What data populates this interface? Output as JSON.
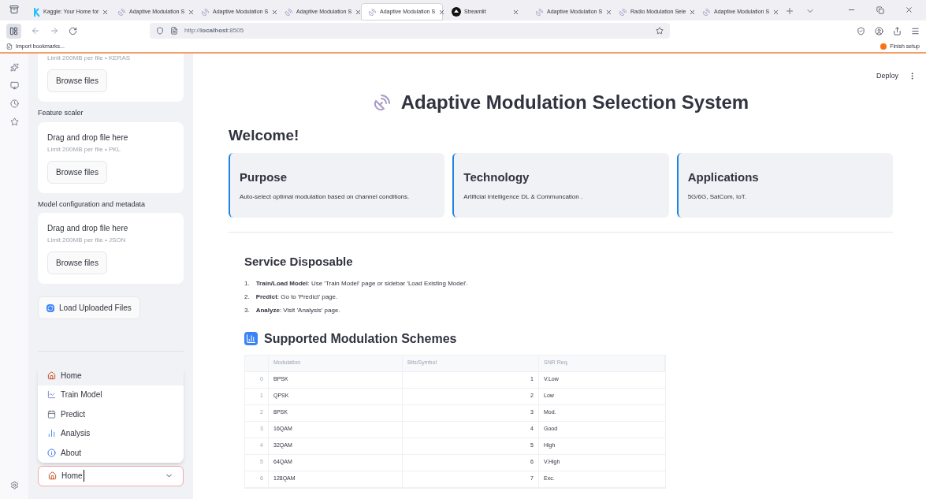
{
  "browser": {
    "tabs": [
      {
        "title": "Kaggle: Your Home for",
        "kind": "kaggle",
        "selected": false
      },
      {
        "title": "Adaptive Modulation S",
        "kind": "app",
        "selected": false
      },
      {
        "title": "Adaptive Modulation S",
        "kind": "app",
        "selected": false
      },
      {
        "title": "Adaptive Modulation S",
        "kind": "app",
        "selected": false
      },
      {
        "title": "Adaptive Modulation S",
        "kind": "app",
        "selected": true
      },
      {
        "title": "Streamlit",
        "kind": "streamlit",
        "selected": false
      },
      {
        "title": "Adaptive Modulation S",
        "kind": "app",
        "selected": false
      },
      {
        "title": "Radio Modulation Sele",
        "kind": "app",
        "selected": false
      },
      {
        "title": "Adaptive Modulation S",
        "kind": "app",
        "selected": false
      }
    ],
    "url": "http://**localhost**:8505",
    "import_bookmarks": "Import bookmarks...",
    "finish_setup": "Finish setup"
  },
  "sidebar": {
    "partial_uploader": {
      "limit": "Limit 200MB per file • KERAS",
      "button": "Browse files"
    },
    "uploaders": [
      {
        "label": "Feature scaler",
        "prompt": "Drag and drop file here",
        "limit": "Limit 200MB per file • PKL",
        "button": "Browse files"
      },
      {
        "label": "Model configuration and metadata",
        "prompt": "Drag and drop file here",
        "limit": "Limit 200MB per file • JSON",
        "button": "Browse files"
      }
    ],
    "load_button": "Load Uploaded Files",
    "nav_menu": [
      {
        "label": "Home",
        "kind": "home",
        "selected": true
      },
      {
        "label": "Train Model",
        "kind": "train",
        "selected": false
      },
      {
        "label": "Predict",
        "kind": "predict",
        "selected": false
      },
      {
        "label": "Analysis",
        "kind": "analysis",
        "selected": false
      },
      {
        "label": "About",
        "kind": "about",
        "selected": false
      }
    ],
    "select": {
      "value": "Home",
      "kind": "home"
    }
  },
  "main": {
    "deploy": "Deploy",
    "title": "Adaptive Modulation Selection System",
    "welcome": "Welcome!",
    "cards": [
      {
        "title": "Purpose",
        "text": "Auto-select optimal modulation based on channel conditions."
      },
      {
        "title": "Technology",
        "text": "Artificial Intelligence DL & Communcation ."
      },
      {
        "title": "Applications",
        "text": "5G/6G, SatCom, IoT."
      }
    ],
    "services_heading": "Service Disposable",
    "steps": [
      {
        "number": "1.",
        "text": "**Train/Load Model**: Use 'Train Model' page or sidebar 'Load Existing Model'."
      },
      {
        "number": "2.",
        "text": "**Predict**: Go to 'Predict' page."
      },
      {
        "number": "3.",
        "text": "**Analyze**: Visit 'Analysis' page."
      }
    ],
    "schemes_heading": "Supported Modulation Schemes",
    "table": {
      "columns": [
        "Modulation",
        "Bits/Symbol",
        "SNR Req."
      ],
      "rows": [
        {
          "index": "0",
          "modulation": "BPSK",
          "bits": "1",
          "snr": "V.Low"
        },
        {
          "index": "1",
          "modulation": "QPSK",
          "bits": "2",
          "snr": "Low"
        },
        {
          "index": "2",
          "modulation": "8PSK",
          "bits": "3",
          "snr": "Mod."
        },
        {
          "index": "3",
          "modulation": "16QAM",
          "bits": "4",
          "snr": "Good"
        },
        {
          "index": "4",
          "modulation": "32QAM",
          "bits": "5",
          "snr": "High"
        },
        {
          "index": "5",
          "modulation": "64QAM",
          "bits": "6",
          "snr": "V.High"
        },
        {
          "index": "6",
          "modulation": "128QAM",
          "bits": "7",
          "snr": "Exc."
        }
      ]
    }
  }
}
